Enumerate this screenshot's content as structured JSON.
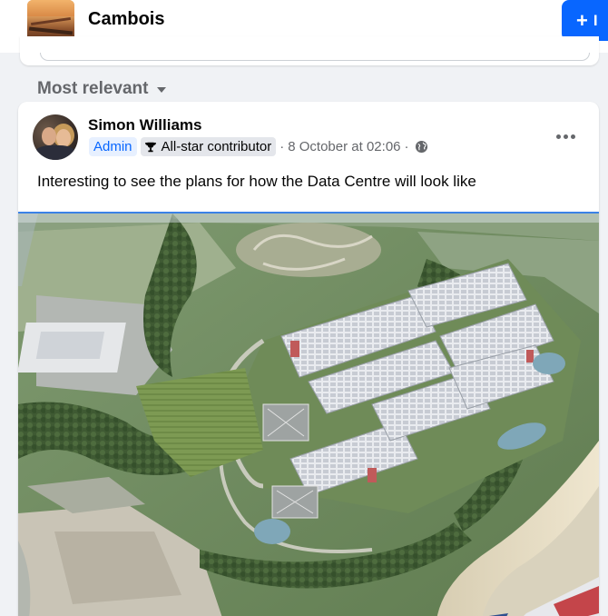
{
  "group": {
    "name": "Cambois",
    "invite_label": "I"
  },
  "feed": {
    "sort_label": "Most relevant"
  },
  "post": {
    "author": "Simon Williams",
    "role_badge": "Admin",
    "contributor_badge": "All-star contributor",
    "separator": "·",
    "timestamp": "8 October at 02:06",
    "timestamp_separator": "·",
    "text": "Interesting to see the plans for how the Data Centre will look like",
    "image_icon": "aerial-render-photo"
  },
  "icons": {
    "plus": "+",
    "trophy": "trophy-icon",
    "globe": "globe-icon",
    "more": "more-horizontal-icon",
    "caret": "caret-down-icon"
  },
  "colors": {
    "accent": "#0866ff",
    "page_bg": "#f0f2f5",
    "secondary_text": "#65676b",
    "divider": "#3b82e6"
  }
}
